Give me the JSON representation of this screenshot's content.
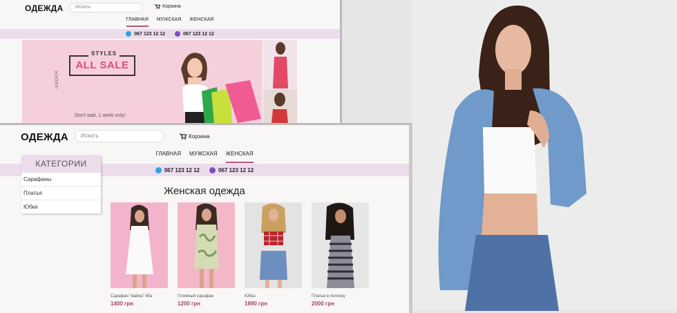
{
  "back_window": {
    "logo": "ОДЕЖДА",
    "search_placeholder": "Искать",
    "cart_label": "Корзина",
    "nav": [
      "ГЛАВНАЯ",
      "МУЖСКАЯ",
      "ЖЕНСКАЯ"
    ],
    "phones": [
      "067 123 12 12",
      "067 123 12 12"
    ],
    "banner": {
      "small": "STYLES",
      "big": "ALL SALE",
      "note": "Don't wait, 1 week only!",
      "side": "UNDER"
    }
  },
  "front_window": {
    "logo": "ОДЕЖДА",
    "search_placeholder": "Искать",
    "cart_label": "Корзина",
    "nav": [
      "ГЛАВНАЯ",
      "МУЖСКАЯ",
      "ЖЕНСКАЯ"
    ],
    "phones": [
      "067 123 12 12",
      "067 123 12 12"
    ],
    "categories": {
      "title": "КАТЕГОРИИ",
      "items": [
        "Сарафаны",
        "Платья",
        "Юбки"
      ]
    },
    "heading": "Женская одежда",
    "products": [
      {
        "name": "Сарафан \"майка\" Mia",
        "price": "1400 грн"
      },
      {
        "name": "Пляжный сарафан",
        "price": "1200 грн"
      },
      {
        "name": "Юбка",
        "price": "1890 грн"
      },
      {
        "name": "Платье в полоску",
        "price": "2000 грн"
      }
    ]
  },
  "colors": {
    "accent": "#b5577a",
    "price": "#a8455e",
    "phone_bar": "#ecdcec",
    "sale": "#e2497d"
  },
  "icons": [
    "cart-icon",
    "telegram-icon",
    "viber-icon"
  ]
}
